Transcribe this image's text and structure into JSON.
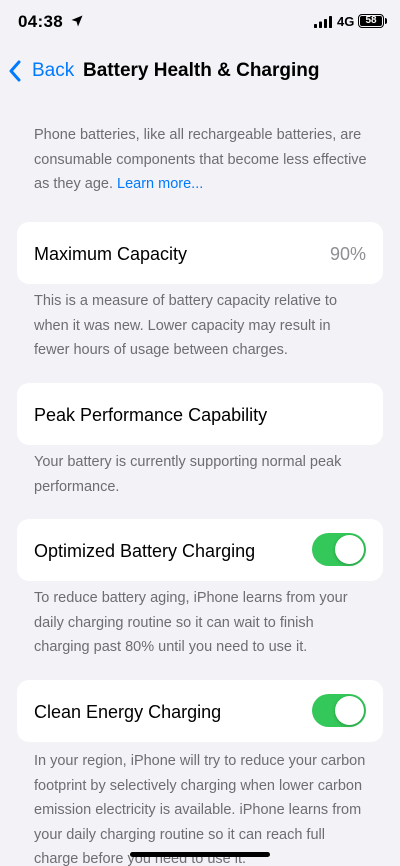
{
  "status_bar": {
    "time": "04:38",
    "network": "4G",
    "battery_percent": "58"
  },
  "nav": {
    "back_label": "Back",
    "title": "Battery Health & Charging"
  },
  "intro": {
    "text": "Phone batteries, like all rechargeable batteries, are consumable components that become less effective as they age. ",
    "link": "Learn more..."
  },
  "max_capacity": {
    "label": "Maximum Capacity",
    "value": "90%",
    "note": "This is a measure of battery capacity relative to when it was new. Lower capacity may result in fewer hours of usage between charges."
  },
  "peak_performance": {
    "label": "Peak Performance Capability",
    "note": "Your battery is currently supporting normal peak performance."
  },
  "optimized_charging": {
    "label": "Optimized Battery Charging",
    "enabled": true,
    "note": "To reduce battery aging, iPhone learns from your daily charging routine so it can wait to finish charging past 80% until you need to use it."
  },
  "clean_energy": {
    "label": "Clean Energy Charging",
    "enabled": true,
    "note": "In your region, iPhone will try to reduce your carbon footprint by selectively charging when lower carbon emission electricity is available. iPhone learns from your daily charging routine so it can reach full charge before you need to use it."
  },
  "colors": {
    "accent": "#007aff",
    "toggle_on": "#34c759",
    "background": "#f2f2f7",
    "secondary_text": "#6d6d72"
  }
}
